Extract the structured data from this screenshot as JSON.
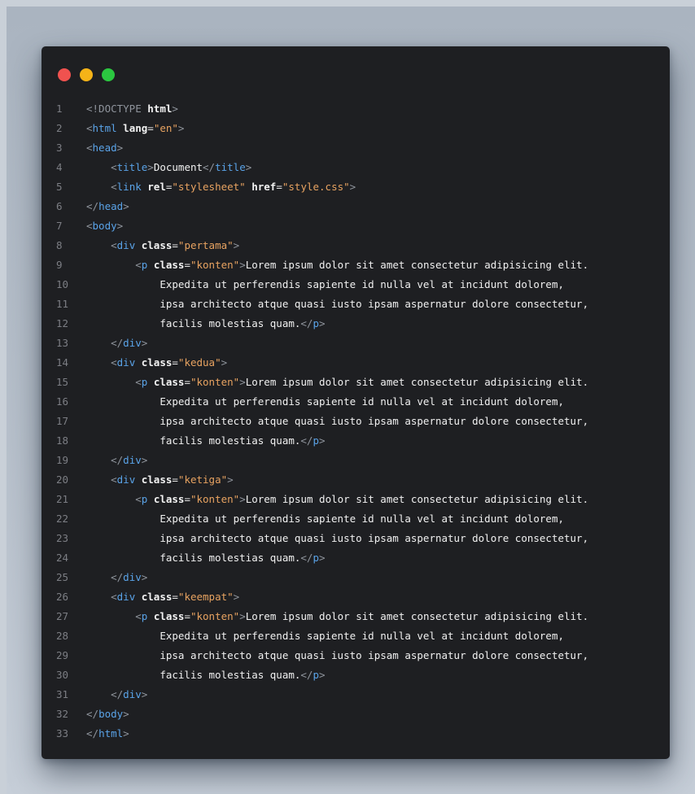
{
  "window": {
    "controls": [
      {
        "name": "close-light",
        "color": "#f0524f"
      },
      {
        "name": "minimize-light",
        "color": "#f5b318"
      },
      {
        "name": "zoom-light",
        "color": "#2bc740"
      }
    ]
  },
  "code": {
    "colors": {
      "punct": "#8f949c",
      "tag": "#5aa3e8",
      "attr": "#f2f2f2",
      "string": "#e8a361",
      "text": "#f0f0f0",
      "line_number": "#7c7e84"
    },
    "lines": [
      {
        "n": "1",
        "indent": "",
        "tokens": [
          [
            "punct",
            "<!DOCTYPE "
          ],
          [
            "attr",
            "html"
          ],
          [
            "punct",
            ">"
          ]
        ]
      },
      {
        "n": "2",
        "indent": "",
        "tokens": [
          [
            "punct",
            "<"
          ],
          [
            "tag",
            "html "
          ],
          [
            "attr",
            "lang"
          ],
          [
            "eq",
            "="
          ],
          [
            "str",
            "\"en\""
          ],
          [
            "punct",
            ">"
          ]
        ]
      },
      {
        "n": "3",
        "indent": "",
        "tokens": [
          [
            "punct",
            "<"
          ],
          [
            "tag",
            "head"
          ],
          [
            "punct",
            ">"
          ]
        ]
      },
      {
        "n": "4",
        "indent": "    ",
        "tokens": [
          [
            "punct",
            "<"
          ],
          [
            "tag",
            "title"
          ],
          [
            "punct",
            ">"
          ],
          [
            "text",
            "Document"
          ],
          [
            "punct",
            "</"
          ],
          [
            "tag",
            "title"
          ],
          [
            "punct",
            ">"
          ]
        ]
      },
      {
        "n": "5",
        "indent": "    ",
        "tokens": [
          [
            "punct",
            "<"
          ],
          [
            "tag",
            "link "
          ],
          [
            "attr",
            "rel"
          ],
          [
            "eq",
            "="
          ],
          [
            "str",
            "\"stylesheet\""
          ],
          [
            "text",
            " "
          ],
          [
            "attr",
            "href"
          ],
          [
            "eq",
            "="
          ],
          [
            "str",
            "\"style.css\""
          ],
          [
            "punct",
            ">"
          ]
        ]
      },
      {
        "n": "6",
        "indent": "",
        "tokens": [
          [
            "punct",
            "</"
          ],
          [
            "tag",
            "head"
          ],
          [
            "punct",
            ">"
          ]
        ]
      },
      {
        "n": "7",
        "indent": "",
        "tokens": [
          [
            "punct",
            "<"
          ],
          [
            "tag",
            "body"
          ],
          [
            "punct",
            ">"
          ]
        ]
      },
      {
        "n": "8",
        "indent": "    ",
        "tokens": [
          [
            "punct",
            "<"
          ],
          [
            "tag",
            "div "
          ],
          [
            "attr",
            "class"
          ],
          [
            "eq",
            "="
          ],
          [
            "str",
            "\"pertama\""
          ],
          [
            "punct",
            ">"
          ]
        ]
      },
      {
        "n": "9",
        "indent": "        ",
        "tokens": [
          [
            "punct",
            "<"
          ],
          [
            "tag",
            "p "
          ],
          [
            "attr",
            "class"
          ],
          [
            "eq",
            "="
          ],
          [
            "str",
            "\"konten\""
          ],
          [
            "punct",
            ">"
          ],
          [
            "text",
            "Lorem ipsum dolor sit amet consectetur adipisicing elit."
          ]
        ]
      },
      {
        "n": "10",
        "indent": "            ",
        "tokens": [
          [
            "text",
            "Expedita ut perferendis sapiente id nulla vel at incidunt dolorem,"
          ]
        ]
      },
      {
        "n": "11",
        "indent": "            ",
        "tokens": [
          [
            "text",
            "ipsa architecto atque quasi iusto ipsam aspernatur dolore consectetur,"
          ]
        ]
      },
      {
        "n": "12",
        "indent": "            ",
        "tokens": [
          [
            "text",
            "facilis molestias quam."
          ],
          [
            "punct",
            "</"
          ],
          [
            "tag",
            "p"
          ],
          [
            "punct",
            ">"
          ]
        ]
      },
      {
        "n": "13",
        "indent": "    ",
        "tokens": [
          [
            "punct",
            "</"
          ],
          [
            "tag",
            "div"
          ],
          [
            "punct",
            ">"
          ]
        ]
      },
      {
        "n": "14",
        "indent": "    ",
        "tokens": [
          [
            "punct",
            "<"
          ],
          [
            "tag",
            "div "
          ],
          [
            "attr",
            "class"
          ],
          [
            "eq",
            "="
          ],
          [
            "str",
            "\"kedua\""
          ],
          [
            "punct",
            ">"
          ]
        ]
      },
      {
        "n": "15",
        "indent": "        ",
        "tokens": [
          [
            "punct",
            "<"
          ],
          [
            "tag",
            "p "
          ],
          [
            "attr",
            "class"
          ],
          [
            "eq",
            "="
          ],
          [
            "str",
            "\"konten\""
          ],
          [
            "punct",
            ">"
          ],
          [
            "text",
            "Lorem ipsum dolor sit amet consectetur adipisicing elit."
          ]
        ]
      },
      {
        "n": "16",
        "indent": "            ",
        "tokens": [
          [
            "text",
            "Expedita ut perferendis sapiente id nulla vel at incidunt dolorem,"
          ]
        ]
      },
      {
        "n": "17",
        "indent": "            ",
        "tokens": [
          [
            "text",
            "ipsa architecto atque quasi iusto ipsam aspernatur dolore consectetur,"
          ]
        ]
      },
      {
        "n": "18",
        "indent": "            ",
        "tokens": [
          [
            "text",
            "facilis molestias quam."
          ],
          [
            "punct",
            "</"
          ],
          [
            "tag",
            "p"
          ],
          [
            "punct",
            ">"
          ]
        ]
      },
      {
        "n": "19",
        "indent": "    ",
        "tokens": [
          [
            "punct",
            "</"
          ],
          [
            "tag",
            "div"
          ],
          [
            "punct",
            ">"
          ]
        ]
      },
      {
        "n": "20",
        "indent": "    ",
        "tokens": [
          [
            "punct",
            "<"
          ],
          [
            "tag",
            "div "
          ],
          [
            "attr",
            "class"
          ],
          [
            "eq",
            "="
          ],
          [
            "str",
            "\"ketiga\""
          ],
          [
            "punct",
            ">"
          ]
        ]
      },
      {
        "n": "21",
        "indent": "        ",
        "tokens": [
          [
            "punct",
            "<"
          ],
          [
            "tag",
            "p "
          ],
          [
            "attr",
            "class"
          ],
          [
            "eq",
            "="
          ],
          [
            "str",
            "\"konten\""
          ],
          [
            "punct",
            ">"
          ],
          [
            "text",
            "Lorem ipsum dolor sit amet consectetur adipisicing elit."
          ]
        ]
      },
      {
        "n": "22",
        "indent": "            ",
        "tokens": [
          [
            "text",
            "Expedita ut perferendis sapiente id nulla vel at incidunt dolorem,"
          ]
        ]
      },
      {
        "n": "23",
        "indent": "            ",
        "tokens": [
          [
            "text",
            "ipsa architecto atque quasi iusto ipsam aspernatur dolore consectetur,"
          ]
        ]
      },
      {
        "n": "24",
        "indent": "            ",
        "tokens": [
          [
            "text",
            "facilis molestias quam."
          ],
          [
            "punct",
            "</"
          ],
          [
            "tag",
            "p"
          ],
          [
            "punct",
            ">"
          ]
        ]
      },
      {
        "n": "25",
        "indent": "    ",
        "tokens": [
          [
            "punct",
            "</"
          ],
          [
            "tag",
            "div"
          ],
          [
            "punct",
            ">"
          ]
        ]
      },
      {
        "n": "26",
        "indent": "    ",
        "tokens": [
          [
            "punct",
            "<"
          ],
          [
            "tag",
            "div "
          ],
          [
            "attr",
            "class"
          ],
          [
            "eq",
            "="
          ],
          [
            "str",
            "\"keempat\""
          ],
          [
            "punct",
            ">"
          ]
        ]
      },
      {
        "n": "27",
        "indent": "        ",
        "tokens": [
          [
            "punct",
            "<"
          ],
          [
            "tag",
            "p "
          ],
          [
            "attr",
            "class"
          ],
          [
            "eq",
            "="
          ],
          [
            "str",
            "\"konten\""
          ],
          [
            "punct",
            ">"
          ],
          [
            "text",
            "Lorem ipsum dolor sit amet consectetur adipisicing elit."
          ]
        ]
      },
      {
        "n": "28",
        "indent": "            ",
        "tokens": [
          [
            "text",
            "Expedita ut perferendis sapiente id nulla vel at incidunt dolorem,"
          ]
        ]
      },
      {
        "n": "29",
        "indent": "            ",
        "tokens": [
          [
            "text",
            "ipsa architecto atque quasi iusto ipsam aspernatur dolore consectetur,"
          ]
        ]
      },
      {
        "n": "30",
        "indent": "            ",
        "tokens": [
          [
            "text",
            "facilis molestias quam."
          ],
          [
            "punct",
            "</"
          ],
          [
            "tag",
            "p"
          ],
          [
            "punct",
            ">"
          ]
        ]
      },
      {
        "n": "31",
        "indent": "    ",
        "tokens": [
          [
            "punct",
            "</"
          ],
          [
            "tag",
            "div"
          ],
          [
            "punct",
            ">"
          ]
        ]
      },
      {
        "n": "32",
        "indent": "",
        "tokens": [
          [
            "punct",
            "</"
          ],
          [
            "tag",
            "body"
          ],
          [
            "punct",
            ">"
          ]
        ]
      },
      {
        "n": "33",
        "indent": "",
        "tokens": [
          [
            "punct",
            "</"
          ],
          [
            "tag",
            "html"
          ],
          [
            "punct",
            ">"
          ]
        ]
      }
    ]
  }
}
